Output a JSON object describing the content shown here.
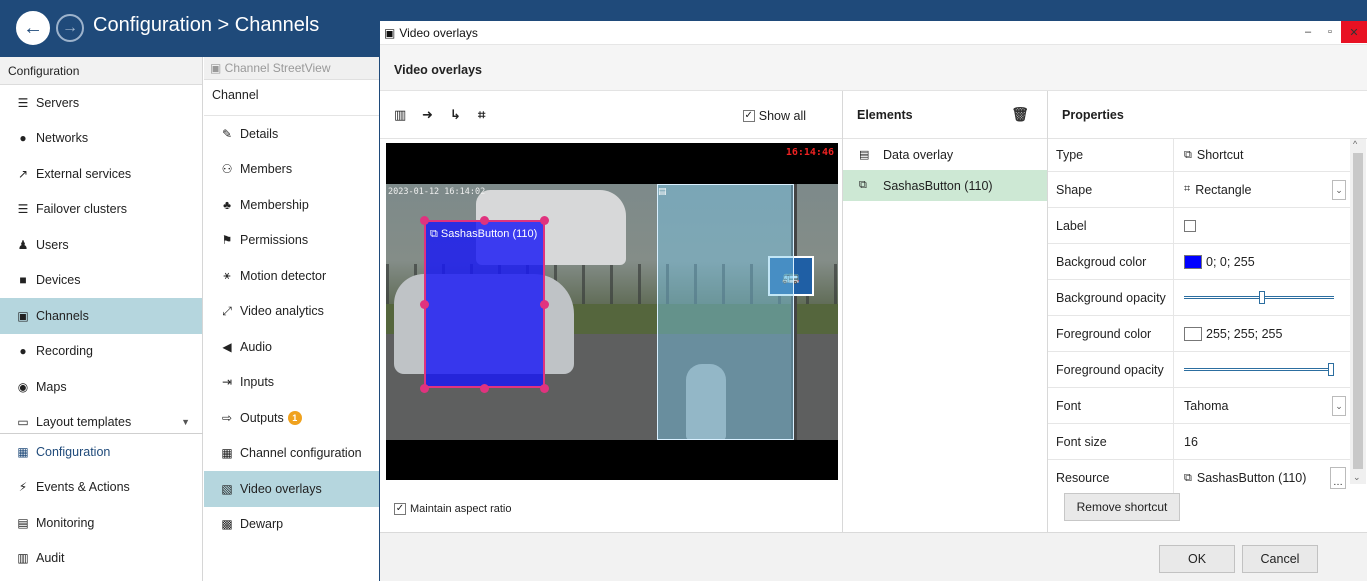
{
  "header": {
    "title": "Configuration > Channels",
    "back_icon": "arrow-left-icon",
    "forward_icon": "arrow-right-icon"
  },
  "left_nav": {
    "heading": "Configuration",
    "items": [
      {
        "label": "Servers",
        "icon": "servers-icon",
        "glyph": "☰"
      },
      {
        "label": "Networks",
        "icon": "globe-icon",
        "glyph": "●"
      },
      {
        "label": "External services",
        "icon": "external-link-icon",
        "glyph": "↗"
      },
      {
        "label": "Failover clusters",
        "icon": "cluster-icon",
        "glyph": "☰"
      },
      {
        "label": "Users",
        "icon": "user-icon",
        "glyph": "♟"
      },
      {
        "label": "Devices",
        "icon": "camera-icon",
        "glyph": "■"
      },
      {
        "label": "Channels",
        "icon": "channels-icon",
        "glyph": "▣"
      },
      {
        "label": "Recording",
        "icon": "record-icon",
        "glyph": "●"
      },
      {
        "label": "Maps",
        "icon": "map-pin-icon",
        "glyph": "◉"
      },
      {
        "label": "Layout templates",
        "icon": "layout-icon",
        "glyph": "▭"
      }
    ],
    "bottom": [
      {
        "label": "Configuration",
        "icon": "configuration-icon",
        "glyph": "▦"
      },
      {
        "label": "Events & Actions",
        "icon": "lightning-icon",
        "glyph": "⚡"
      },
      {
        "label": "Monitoring",
        "icon": "monitoring-icon",
        "glyph": "▤"
      },
      {
        "label": "Audit",
        "icon": "audit-icon",
        "glyph": "▥"
      }
    ]
  },
  "channel_nav": {
    "heading": "Channel StreetView",
    "subheading": "Channel",
    "items": [
      {
        "label": "Details",
        "icon": "pencil-icon",
        "glyph": "✎"
      },
      {
        "label": "Members",
        "icon": "members-icon",
        "glyph": "⚇"
      },
      {
        "label": "Membership",
        "icon": "membership-icon",
        "glyph": "♣"
      },
      {
        "label": "Permissions",
        "icon": "permissions-icon",
        "glyph": "⚑"
      },
      {
        "label": "Motion detector",
        "icon": "running-icon",
        "glyph": "⚹"
      },
      {
        "label": "Video analytics",
        "icon": "analytics-icon",
        "glyph": "⤢"
      },
      {
        "label": "Audio",
        "icon": "speaker-icon",
        "glyph": "◀"
      },
      {
        "label": "Inputs",
        "icon": "input-icon",
        "glyph": "⇥"
      },
      {
        "label": "Outputs",
        "icon": "output-icon",
        "glyph": "⇨",
        "badge": "1"
      },
      {
        "label": "Channel configuration",
        "icon": "channel-config-icon",
        "glyph": "▦"
      },
      {
        "label": "Video overlays",
        "icon": "overlay-icon",
        "glyph": "▧"
      },
      {
        "label": "Dewarp",
        "icon": "dewarp-icon",
        "glyph": "▩"
      }
    ]
  },
  "dialog": {
    "title": "Video overlays",
    "header": "Video overlays",
    "show_all": "Show all",
    "maintain_aspect": "Maintain aspect ratio",
    "timestamp_right": "16:14:46",
    "timestamp_left": "2023-01-12 16:14:02",
    "overlay_label": "SashasButton (110)",
    "elements": {
      "heading": "Elements",
      "items": [
        {
          "label": "Data overlay",
          "icon": "data-overlay-icon"
        },
        {
          "label": "SashasButton (110)",
          "icon": "shortcut-icon"
        }
      ]
    },
    "properties": {
      "heading": "Properties",
      "rows": {
        "type": {
          "name": "Type",
          "value": "Shortcut"
        },
        "shape": {
          "name": "Shape",
          "value": "Rectangle"
        },
        "label": {
          "name": "Label"
        },
        "bg_color": {
          "name": "Backgroud color",
          "value": "0; 0; 255",
          "color": "#0000ff"
        },
        "bg_opacity": {
          "name": "Background opacity",
          "level": 0.52
        },
        "fg_color": {
          "name": "Foreground color",
          "value": "255; 255; 255",
          "color": "#ffffff"
        },
        "fg_opacity": {
          "name": "Foreground opacity",
          "level": 1.0
        },
        "font": {
          "name": "Font",
          "value": "Tahoma"
        },
        "font_size": {
          "name": "Font size",
          "value": "16"
        },
        "resource": {
          "name": "Resource",
          "value": "SashasButton (110)"
        }
      },
      "remove_button": "Remove shortcut"
    },
    "ok": "OK",
    "cancel": "Cancel"
  },
  "colors": {
    "header": "#1f4a7a",
    "active_nav": "#b5d6de",
    "selected_element": "#cde8d4",
    "overlay_border": "#e0337f",
    "close_button": "#e81123"
  }
}
